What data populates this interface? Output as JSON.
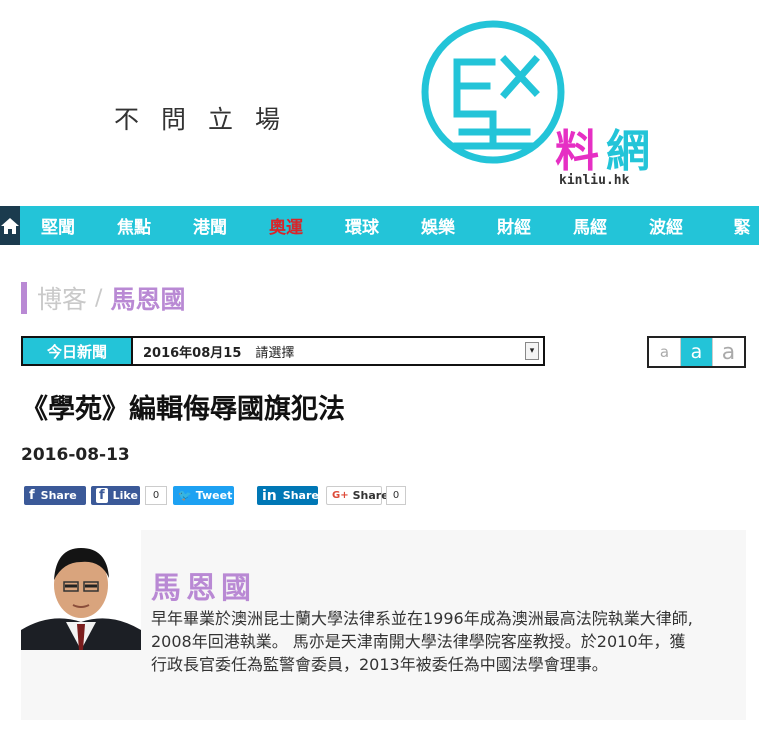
{
  "header": {
    "slogan": "不問立場",
    "logo_big_char": "堅",
    "logo_sub": "料網",
    "logo_url": "kinliu.hk"
  },
  "nav": {
    "items": [
      "堅聞",
      "焦點",
      "港聞",
      "奧運",
      "環球",
      "娛樂",
      "財經",
      "馬經",
      "波經",
      "緊"
    ],
    "active": "奧運",
    "colors": {
      "bar": "#23c4d8",
      "home_bg": "#1b3b4e",
      "active_text": "#d9252a"
    }
  },
  "breadcrumb": {
    "section": "博客",
    "separator": "/",
    "author": "馬恩國"
  },
  "date_selector": {
    "label": "今日新聞",
    "date": "2016年08月15",
    "placeholder": "請選擇"
  },
  "font_switch": [
    "a",
    "a",
    "a"
  ],
  "article": {
    "title": "《學苑》編輯侮辱國旗犯法",
    "date": "2016-08-13"
  },
  "share": {
    "facebook_share": "Share",
    "facebook_like": "Like",
    "like_count": "0",
    "tweet": "Tweet",
    "linkedin": "Share",
    "google_share": "Share",
    "google_count": "0"
  },
  "author_box": {
    "name": "馬恩國",
    "bio": "早年畢業於澳洲昆士蘭大學法律系並在1996年成為澳洲最高法院執業大律師, 2008年回港執業。 馬亦是天津南開大學法律學院客座教授。於2010年，獲行政長官委任為監警會委員，2013年被委任為中國法學會理事。"
  }
}
